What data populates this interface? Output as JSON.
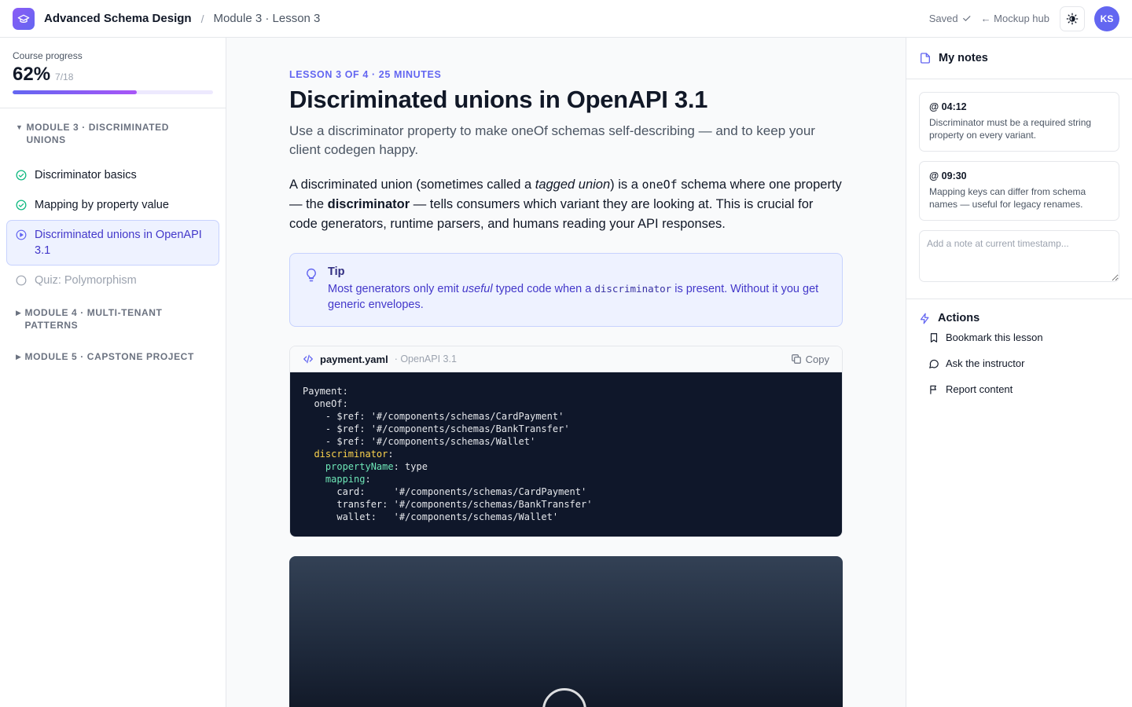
{
  "header": {
    "course_title": "Advanced Schema Design",
    "separator": "/",
    "lesson_crumb": "Module 3 · Lesson 3",
    "saved_label": "Saved",
    "hub_link": "← Mockup hub",
    "avatar_initials": "KS"
  },
  "progress": {
    "label": "Course progress",
    "percent_label": "62%",
    "percent": 62,
    "count": "7/18"
  },
  "sidebar": {
    "module3": {
      "title": "Module 3 · Discriminated unions",
      "lessons": [
        {
          "label": "Discriminator basics",
          "state": "done"
        },
        {
          "label": "Mapping by property value",
          "state": "done"
        },
        {
          "label": "Discriminated unions in OpenAPI 3.1",
          "state": "active"
        },
        {
          "label": "Quiz: Polymorphism",
          "state": "locked"
        }
      ]
    },
    "module4": {
      "title": "Module 4 · Multi-tenant patterns"
    },
    "module5": {
      "title": "Module 5 · Capstone project"
    }
  },
  "lesson": {
    "eyebrow": "Lesson 3 of 4 · 25 minutes",
    "title": "Discriminated unions in OpenAPI 3.1",
    "subtitle": "Use a discriminator property to make oneOf schemas self-describing — and to keep your client codegen happy.",
    "para": {
      "p1": "A discriminated union (sometimes called a ",
      "em": "tagged union",
      "p2": ") is a ",
      "code": "oneOf",
      "p3": " schema where one property — the ",
      "strong": "discriminator",
      "p4": " — tells consumers which variant they are looking at. This is crucial for code generators, runtime parsers, and humans reading your API responses."
    },
    "tip": {
      "title": "Tip",
      "t1": "Most generators only emit ",
      "em": "useful",
      "t2": " typed code when a ",
      "code": "discriminator",
      "t3": " is present. Without it you get generic envelopes."
    },
    "code": {
      "filename": "payment.yaml",
      "lang": "· OpenAPI 3.1",
      "copy_label": "Copy",
      "lines": {
        "l1": "Payment:",
        "l2": "  oneOf:",
        "l3": "    - $ref: '#/components/schemas/CardPayment'",
        "l4": "    - $ref: '#/components/schemas/BankTransfer'",
        "l5": "    - $ref: '#/components/schemas/Wallet'",
        "l6_key": "discriminator",
        "l7_key": "propertyName",
        "l7_val": ": type",
        "l8_key": "mapping",
        "l9": "      card:     '#/components/schemas/CardPayment'",
        "l10": "      transfer: '#/components/schemas/BankTransfer'",
        "l11": "      wallet:   '#/components/schemas/Wallet'"
      }
    }
  },
  "notes": {
    "title": "My notes",
    "items": [
      {
        "time": "@ 04:12",
        "text": "Discriminator must be a required string property on every variant."
      },
      {
        "time": "@ 09:30",
        "text": "Mapping keys can differ from schema names — useful for legacy renames."
      }
    ],
    "input_placeholder": "Add a note at current timestamp..."
  },
  "actions": {
    "title": "Actions",
    "items": [
      {
        "label": "Bookmark this lesson",
        "icon": "bookmark-icon"
      },
      {
        "label": "Ask the instructor",
        "icon": "chat-bubble-icon"
      },
      {
        "label": "Report content",
        "icon": "flag-icon"
      }
    ]
  },
  "colors": {
    "accent": "#6366f1",
    "success": "#10b981",
    "code_bg": "#0f172a"
  }
}
